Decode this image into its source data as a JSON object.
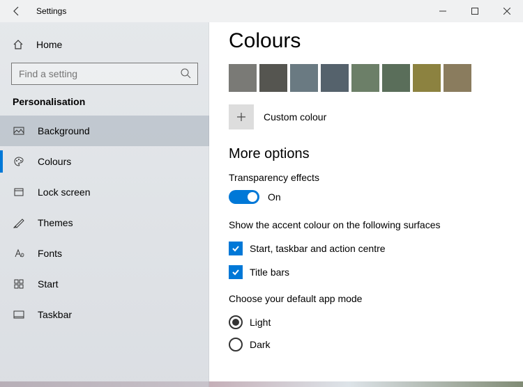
{
  "titlebar": {
    "title": "Settings"
  },
  "sidebar": {
    "home": "Home",
    "search_placeholder": "Find a setting",
    "category": "Personalisation",
    "items": [
      {
        "label": "Background",
        "icon": "picture"
      },
      {
        "label": "Colours",
        "icon": "palette"
      },
      {
        "label": "Lock screen",
        "icon": "lockscreen"
      },
      {
        "label": "Themes",
        "icon": "themes"
      },
      {
        "label": "Fonts",
        "icon": "fonts"
      },
      {
        "label": "Start",
        "icon": "start"
      },
      {
        "label": "Taskbar",
        "icon": "taskbar"
      }
    ],
    "selected_index": 0,
    "active_index": 1
  },
  "main": {
    "heading": "Colours",
    "swatches": [
      "#7a7a76",
      "#555550",
      "#6a7a82",
      "#55626c",
      "#6c7f68",
      "#5a6e5a",
      "#8c8240",
      "#8a7c5e"
    ],
    "custom_label": "Custom colour",
    "more_heading": "More options",
    "transparency_label": "Transparency effects",
    "transparency_state": "On",
    "accent_label": "Show the accent colour on the following surfaces",
    "check1": "Start, taskbar and action centre",
    "check2": "Title bars",
    "mode_label": "Choose your default app mode",
    "mode_light": "Light",
    "mode_dark": "Dark"
  }
}
